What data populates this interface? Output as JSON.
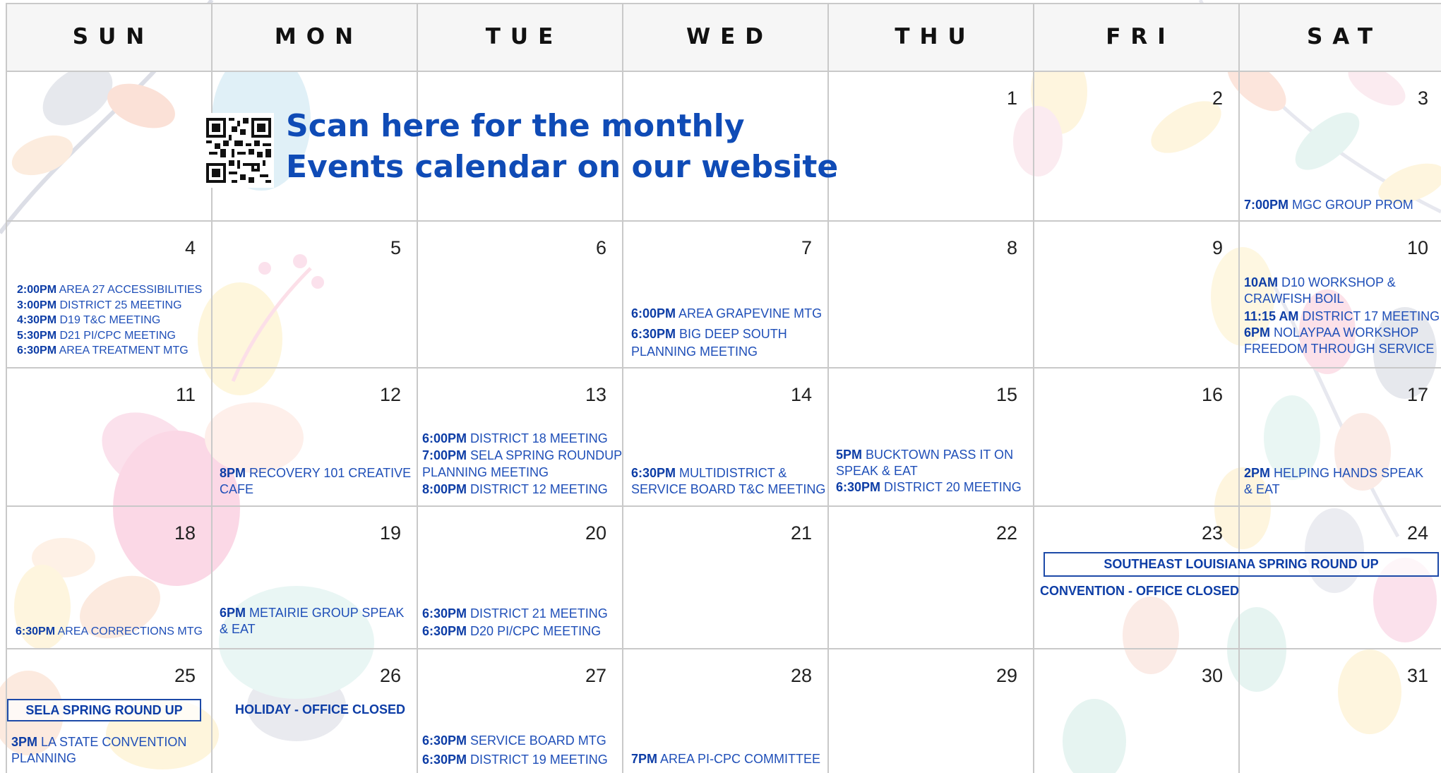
{
  "weekdays": [
    "SUN",
    "MON",
    "TUE",
    "WED",
    "THU",
    "FRI",
    "SAT"
  ],
  "promo": {
    "line1": "Scan here for the monthly",
    "line2": "Events calendar on our website"
  },
  "days": {
    "d1": "1",
    "d2": "2",
    "d3": "3",
    "d4": "4",
    "d5": "5",
    "d6": "6",
    "d7": "7",
    "d8": "8",
    "d9": "9",
    "d10": "10",
    "d11": "11",
    "d12": "12",
    "d13": "13",
    "d14": "14",
    "d15": "15",
    "d16": "16",
    "d17": "17",
    "d18": "18",
    "d19": "19",
    "d20": "20",
    "d21": "21",
    "d22": "22",
    "d23": "23",
    "d24": "24",
    "d25": "25",
    "d26": "26",
    "d27": "27",
    "d28": "28",
    "d29": "29",
    "d30": "30",
    "d31": "31"
  },
  "events": {
    "e3": [
      {
        "time": "7:00PM",
        "text": "MGC GROUP PROM"
      }
    ],
    "e4": [
      {
        "time": "2:00PM",
        "text": "AREA 27 ACCESSIBILITIES"
      },
      {
        "time": "3:00PM",
        "text": "DISTRICT 25 MEETING"
      },
      {
        "time": "4:30PM",
        "text": "D19 T&C MEETING"
      },
      {
        "time": "5:30PM",
        "text": "D21 PI/CPC MEETING"
      },
      {
        "time": "6:30PM",
        "text": "AREA TREATMENT MTG"
      }
    ],
    "e7": [
      {
        "time": "6:00PM",
        "text": "AREA GRAPEVINE MTG"
      },
      {
        "time": "6:30PM",
        "text": "BIG DEEP SOUTH"
      },
      {
        "time": "",
        "text": "PLANNING MEETING"
      }
    ],
    "e10": [
      {
        "time": "10AM",
        "text": "D10 WORKSHOP &"
      },
      {
        "time": "",
        "text": "CRAWFISH BOIL"
      },
      {
        "time": "11:15 AM",
        "text": "DISTRICT 17 MEETING"
      },
      {
        "time": "6PM",
        "text": "NOLAYPAA WORKSHOP"
      },
      {
        "time": "",
        "text": "FREEDOM THROUGH SERVICE"
      }
    ],
    "e12": [
      {
        "time": "8PM",
        "text": "RECOVERY 101 CREATIVE"
      },
      {
        "time": "",
        "text": "CAFE"
      }
    ],
    "e13": [
      {
        "time": "6:00PM",
        "text": "DISTRICT 18 MEETING"
      },
      {
        "time": "7:00PM",
        "text": "SELA SPRING ROUNDUP"
      },
      {
        "time": "",
        "text": "PLANNING MEETING"
      },
      {
        "time": "8:00PM",
        "text": "DISTRICT 12 MEETING"
      }
    ],
    "e14": [
      {
        "time": "6:30PM",
        "text": "MULTIDISTRICT &"
      },
      {
        "time": "",
        "text": "SERVICE BOARD T&C MEETING"
      }
    ],
    "e15": [
      {
        "time": "5PM",
        "text": "BUCKTOWN PASS IT ON"
      },
      {
        "time": "",
        "text": "SPEAK & EAT"
      },
      {
        "time": "6:30PM",
        "text": "DISTRICT 20 MEETING"
      }
    ],
    "e17": [
      {
        "time": "2PM",
        "text": "HELPING HANDS  SPEAK"
      },
      {
        "time": "",
        "text": "& EAT"
      }
    ],
    "e18": [
      {
        "time": "6:30PM",
        "text": "AREA CORRECTIONS MTG"
      }
    ],
    "e19": [
      {
        "time": "6PM",
        "text": "METAIRIE GROUP  SPEAK"
      },
      {
        "time": "",
        "text": "& EAT"
      }
    ],
    "e20": [
      {
        "time": "6:30PM",
        "text": "DISTRICT 21 MEETING"
      },
      {
        "time": "6:30PM",
        "text": "D20 PI/CPC MEETING"
      }
    ],
    "e25": [
      {
        "time": "3PM",
        "text": "LA STATE CONVENTION"
      },
      {
        "time": "",
        "text": "PLANNING"
      }
    ],
    "e27": [
      {
        "time": "6:30PM",
        "text": "SERVICE BOARD MTG"
      },
      {
        "time": "6:30PM",
        "text": "DISTRICT 19 MEETING"
      }
    ],
    "e28": [
      {
        "time": "7PM",
        "text": "AREA PI-CPC COMMITTEE"
      }
    ]
  },
  "banners": {
    "sela_convention": "SOUTHEAST LOUISIANA SPRING ROUND UP",
    "convention_closed": "CONVENTION - OFFICE CLOSED",
    "sela_spring": "SELA SPRING ROUND UP",
    "holiday": "HOLIDAY - OFFICE CLOSED"
  },
  "colors": {
    "accent": "#0d3da6",
    "event_text": "#1f4fb8",
    "grid": "#c9c9c9",
    "header_bg": "#f6f6f6"
  }
}
